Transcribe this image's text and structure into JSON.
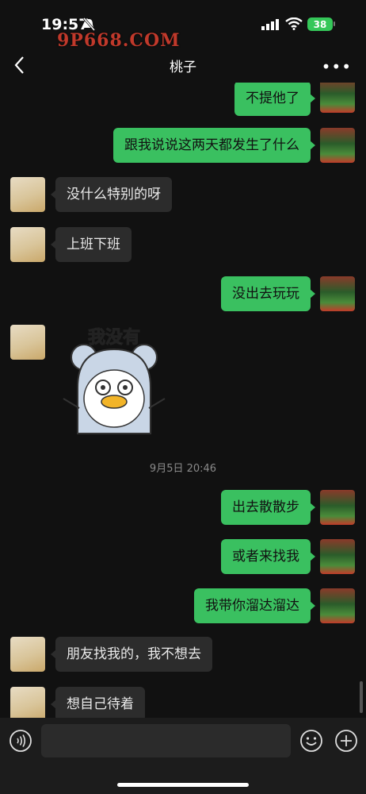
{
  "status": {
    "time": "19:57",
    "watermark": "9P668.COM",
    "battery": "38"
  },
  "nav": {
    "title": "桃子",
    "more": "•••"
  },
  "messages": [
    {
      "from": "me",
      "text": "不提他了"
    },
    {
      "from": "me",
      "text": "跟我说说这两天都发生了什么"
    },
    {
      "from": "her",
      "text": "没什么特别的呀"
    },
    {
      "from": "her",
      "text": "上班下班"
    },
    {
      "from": "me",
      "text": "没出去玩玩"
    },
    {
      "from": "her",
      "sticker_text": "我没有"
    },
    {
      "timestamp": "9月5日 20:46"
    },
    {
      "from": "me",
      "text": "出去散散步"
    },
    {
      "from": "me",
      "text": "或者来找我"
    },
    {
      "from": "me",
      "text": "我带你溜达溜达"
    },
    {
      "from": "her",
      "text": "朋友找我的，我不想去"
    },
    {
      "from": "her",
      "text": "想自己待着"
    }
  ],
  "colors": {
    "me_bubble": "#3ac060",
    "her_bubble": "#2c2c2c",
    "background": "#111111"
  },
  "icons": {
    "voice": "voice-icon",
    "emoji": "emoji-icon",
    "plus": "plus-icon",
    "back": "back-chevron-icon"
  }
}
